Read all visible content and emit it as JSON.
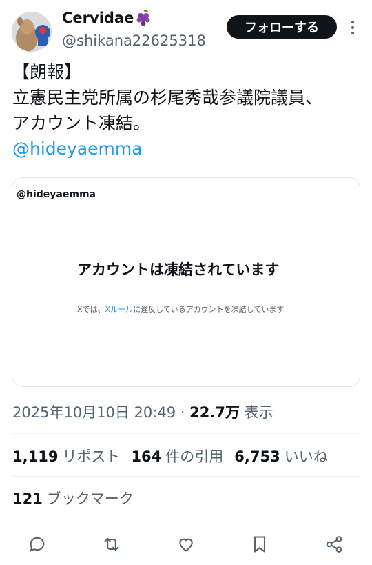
{
  "author": {
    "display_name": "Cervidae",
    "emoji": "grapes-emoji",
    "handle": "@shikana22625318"
  },
  "follow_label": "フォローする",
  "tweet": {
    "lines": [
      "【朗報】",
      "立憲民主党所属の杉尾秀哉参議院議員、",
      "アカウント凍結。"
    ],
    "mention": "@hideyaemma"
  },
  "card": {
    "handle": "@hideyaemma",
    "heading": "アカウントは凍結されています",
    "sub_prefix": "Xでは、",
    "sub_link": "Xルール",
    "sub_suffix": "に違反しているアカウントを凍結しています"
  },
  "meta": {
    "timestamp": "2025年10月10日 20:49",
    "separator": " · ",
    "views_count": "22.7万",
    "views_label": " 表示"
  },
  "stats": {
    "reposts_count": "1,119",
    "reposts_label": "リポスト",
    "quotes_count": "164",
    "quotes_label": "件の引用",
    "likes_count": "6,753",
    "likes_label": "いいね",
    "bookmarks_count": "121",
    "bookmarks_label": "ブックマーク"
  },
  "colors": {
    "text": "#0f1419",
    "secondary": "#536471",
    "link": "#1d9bf0",
    "border": "#e1e8ed"
  },
  "action_icons": [
    "reply-icon",
    "repost-icon",
    "like-icon",
    "bookmark-icon",
    "share-icon"
  ]
}
